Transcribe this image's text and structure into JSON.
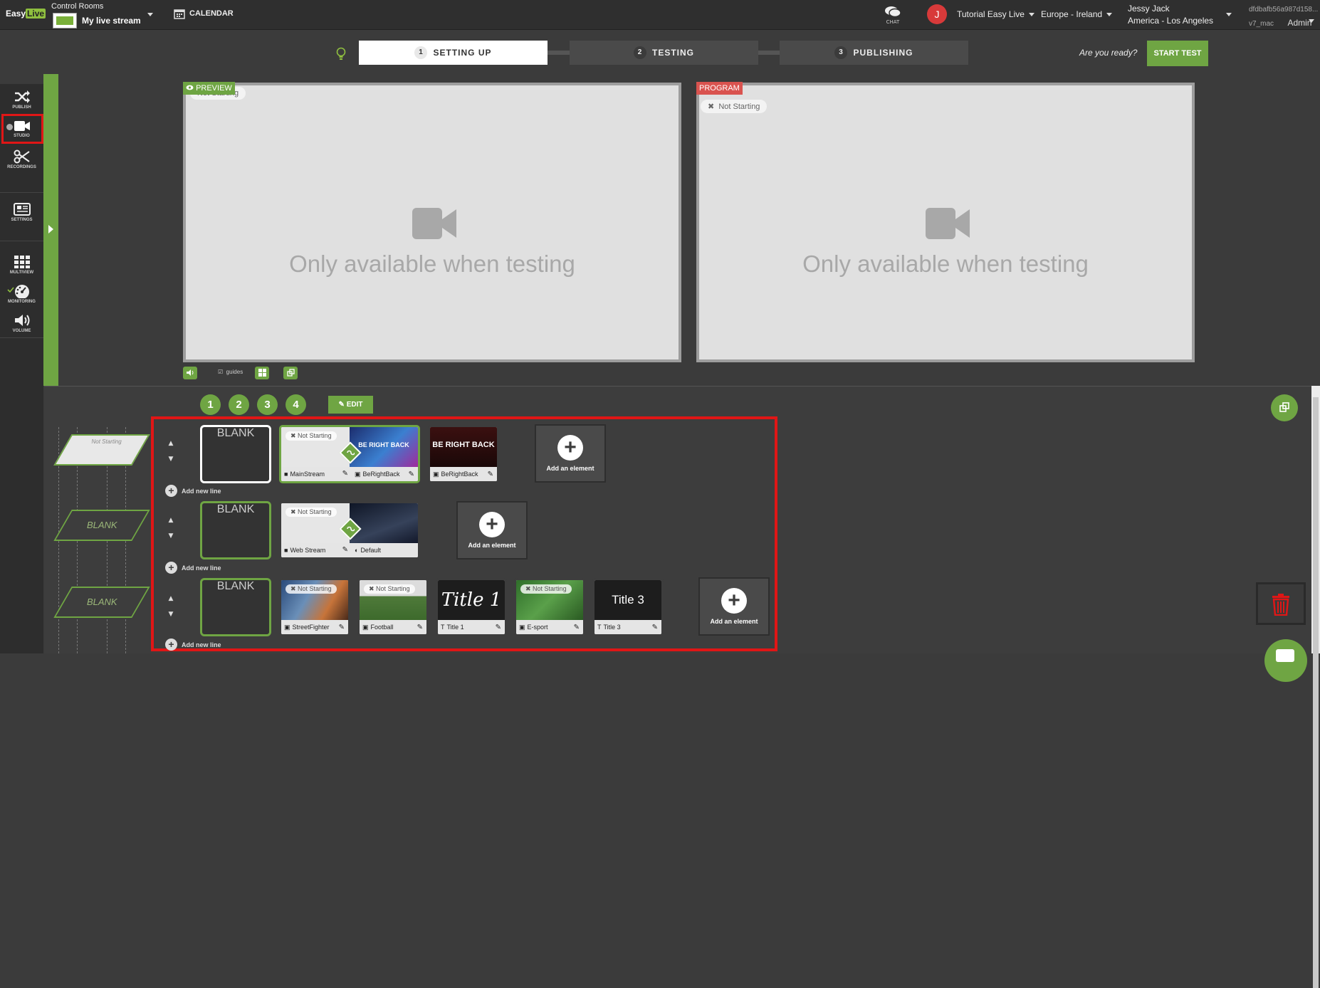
{
  "topbar": {
    "logo": "Easy",
    "logo_accent": "Live",
    "control_rooms_label": "Control Rooms",
    "stream_name": "My live stream",
    "calendar_label": "CALENDAR",
    "chat_label": "CHAT",
    "avatar_initial": "J",
    "tutorial_label": "Tutorial Easy Live",
    "region_label": "Europe - Ireland",
    "user_name": "Jessy Jack",
    "user_timezone": "America - Los Angeles",
    "instance_id": "dfdbafb56a987d158...",
    "instance_tag": "v7_mac",
    "role": "Admin"
  },
  "steps": {
    "items": [
      {
        "number": "1",
        "label": "SETTING UP"
      },
      {
        "number": "2",
        "label": "TESTING"
      },
      {
        "number": "3",
        "label": "PUBLISHING"
      }
    ],
    "ready_text": "Are you ready?",
    "start_button": "START TEST"
  },
  "leftnav": {
    "publish": "PUBLISH",
    "studio": "STUDIO",
    "recordings": "RECORDINGS",
    "settings": "SETTINGS",
    "multiview": "MULTIVIEW",
    "monitoring": "MONITORING",
    "volume": "VOLUME"
  },
  "preview": {
    "label": "PREVIEW",
    "status": "Not Starting",
    "message": "Only available when testing"
  },
  "program": {
    "label": "PROGRAM",
    "status": "Not Starting",
    "message": "Only available when testing"
  },
  "controls": {
    "guides_label": "guides"
  },
  "layers": {
    "numbers": [
      "1",
      "2",
      "3",
      "4"
    ],
    "edit_label": "EDIT"
  },
  "scenes": {
    "add_line": "Add new line",
    "add_element": "Add an element",
    "blank": "BLANK",
    "not_starting": "Not Starting",
    "row1": {
      "scene_label": "Not Starting",
      "tiles": [
        {
          "name": "MainStream",
          "overlay": "BE RIGHT BACK",
          "overlay_name": "BeRightBack"
        },
        {
          "name": "BeRightBack",
          "overlay": "BE RIGHT BACK"
        }
      ]
    },
    "row2": {
      "scene_label": "BLANK",
      "tiles": [
        {
          "name": "Web Stream",
          "overlay_name": "Default"
        }
      ]
    },
    "row3": {
      "scene_label": "BLANK",
      "tiles": [
        {
          "name": "StreetFighter"
        },
        {
          "name": "Football"
        },
        {
          "name": "Title 1",
          "display": "Title 1"
        },
        {
          "name": "E-sport"
        },
        {
          "name": "Title 3",
          "display": "Title 3"
        }
      ]
    }
  },
  "colors": {
    "accent": "#6fa543",
    "highlight": "#e01616",
    "program_label": "#d9534f"
  }
}
